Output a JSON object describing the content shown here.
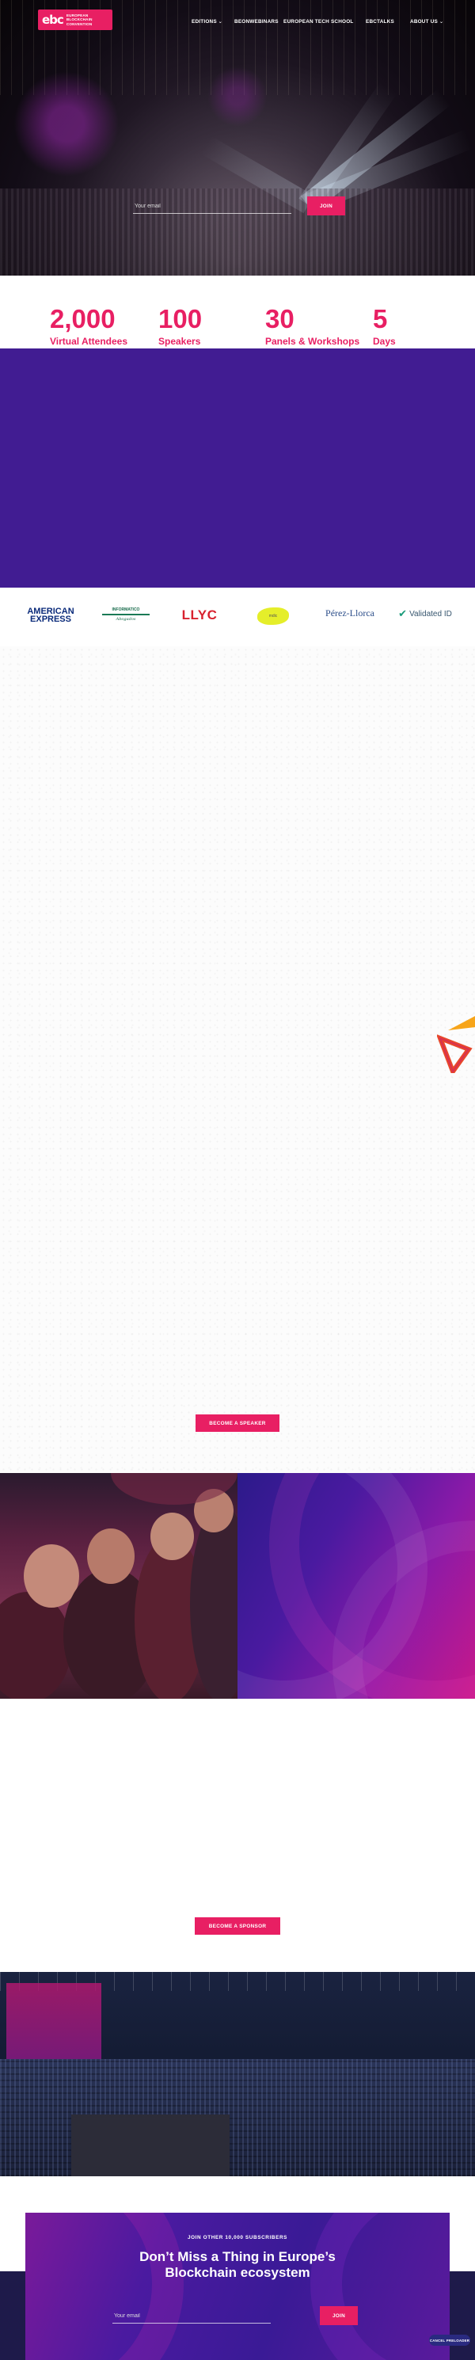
{
  "brand": {
    "logo_mark": "ebc",
    "logo_lines": [
      "EUROPEAN",
      "BLOCKCHAIN",
      "CONVENTION"
    ],
    "accent": "#e81f63",
    "purple": "#411c92"
  },
  "nav": {
    "editions": "EDITIONS",
    "webinars": "BEONWEBINARS",
    "tech_school": "EUROPEAN TECH SCHOOL",
    "ebctalks": "EBCTALKS",
    "about": "ABOUT US"
  },
  "hero_form": {
    "placeholder": "Your email",
    "join_label": "JOIN"
  },
  "stats": [
    {
      "value": "2,000",
      "label": "Virtual Attendees"
    },
    {
      "value": "100",
      "label": "Speakers"
    },
    {
      "value": "30",
      "label": "Panels & Workshops"
    },
    {
      "value": "5",
      "label": "Days"
    }
  ],
  "partners": {
    "amex_line1": "AMERICAN",
    "amex_line2": "EXPRESS",
    "informatico_line1": "INFORMATICO",
    "informatico_line2": "Abogados",
    "llyc": "LLYC",
    "mdic": "mdic",
    "perez": "Pérez-Llorca",
    "validated": "Validated ID"
  },
  "buttons": {
    "become_speaker": "BECOME A SPEAKER",
    "become_sponsor": "BECOME A SPONSOR"
  },
  "newsletter": {
    "eyebrow": "JOIN OTHER 10,000 SUBSCRIBERS",
    "title_line1": "Don’t Miss a Thing in Europe’s",
    "title_line2": "Blockchain ecosystem",
    "placeholder": "Your email",
    "join_label": "JOIN"
  },
  "cancel_label": "CANCEL PRELOADER",
  "icons": {
    "chevron": "chevron-down-icon",
    "triangle": "triangle-decoration-icon",
    "check": "check-icon"
  }
}
